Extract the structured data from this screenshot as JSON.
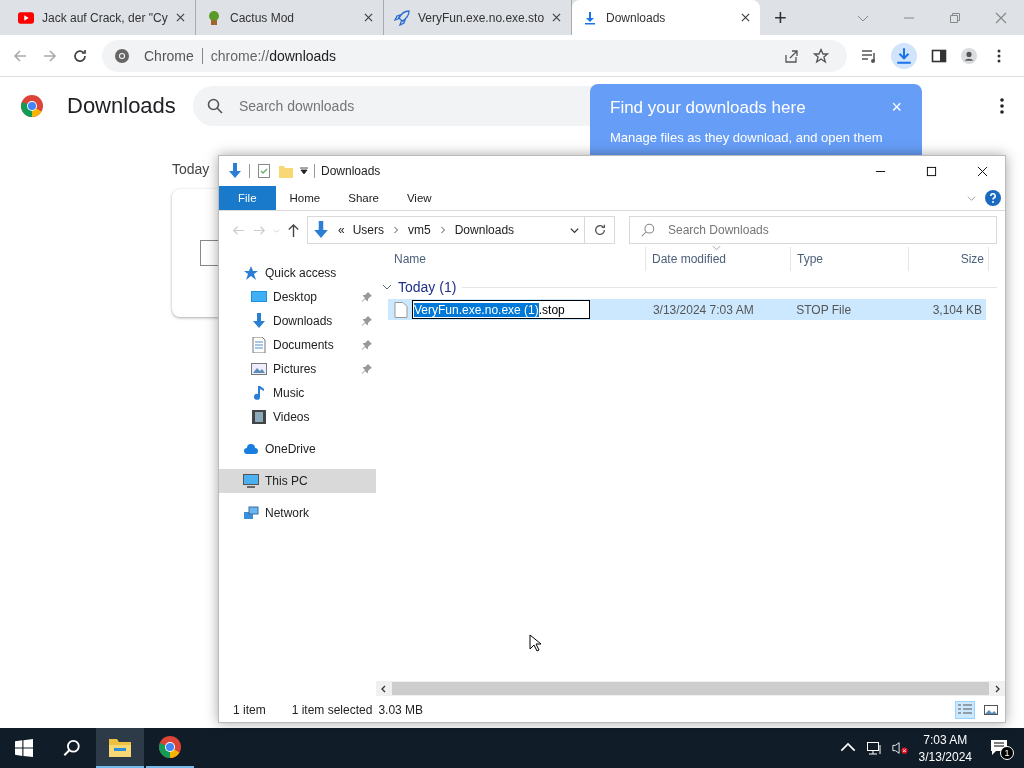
{
  "browser": {
    "tabs": [
      {
        "title": "Jack auf Crack, der \"Cy",
        "selected": false
      },
      {
        "title": "Cactus Mod",
        "selected": false
      },
      {
        "title": "VeryFun.exe.no.exe.sto",
        "selected": false
      },
      {
        "title": "Downloads",
        "selected": true
      }
    ],
    "new_tab": "+",
    "omnibox": {
      "site": "Chrome",
      "url_scheme": "chrome://",
      "url_path": "downloads"
    }
  },
  "page": {
    "title": "Downloads",
    "search": {
      "placeholder": "Search downloads"
    },
    "section": "Today",
    "promo": {
      "title": "Find your downloads here",
      "body": "Manage files as they download, and open them",
      "close": "×"
    }
  },
  "explorer": {
    "title": "Downloads",
    "ribbon_tabs": [
      {
        "label": "File",
        "selected": true
      },
      {
        "label": "Home",
        "selected": false
      },
      {
        "label": "Share",
        "selected": false
      },
      {
        "label": "View",
        "selected": false
      }
    ],
    "address": {
      "overflow": "«",
      "path": [
        "Users",
        "vm5",
        "Downloads"
      ]
    },
    "search": {
      "placeholder": "Search Downloads"
    },
    "nav": [
      {
        "label": "Quick access",
        "selected": false,
        "children": [
          {
            "label": "Desktop",
            "pinned": true,
            "selected": false
          },
          {
            "label": "Downloads",
            "pinned": true,
            "selected": false
          },
          {
            "label": "Documents",
            "pinned": true,
            "selected": false
          },
          {
            "label": "Pictures",
            "pinned": true,
            "selected": false
          },
          {
            "label": "Music",
            "pinned": false,
            "selected": false
          },
          {
            "label": "Videos",
            "pinned": false,
            "selected": false
          }
        ]
      },
      {
        "label": "OneDrive",
        "selected": false
      },
      {
        "label": "This PC",
        "selected": true
      },
      {
        "label": "Network",
        "selected": false
      }
    ],
    "columns": [
      "Name",
      "Date modified",
      "Type",
      "Size"
    ],
    "groups": [
      {
        "label": "Today (1)",
        "expanded": true,
        "files": [
          {
            "name_selected": "VeryFun.exe.no.exe (1)",
            "name_rest": ".stop",
            "renaming": true,
            "selected": true,
            "date": "3/13/2024 7:03 AM",
            "type": "STOP File",
            "size": "3,104 KB"
          }
        ]
      }
    ],
    "status": {
      "count": "1 item",
      "selection": "1 item selected",
      "selection_size": "3.03 MB"
    },
    "views": [
      {
        "kind": "details",
        "selected": true
      },
      {
        "kind": "tiles",
        "selected": false
      }
    ]
  },
  "taskbar": {
    "apps": [
      {
        "kind": "explorer",
        "selected": true
      },
      {
        "kind": "chrome",
        "selected": false
      }
    ],
    "time": "7:03 AM",
    "date": "3/13/2024",
    "notifications": "1"
  }
}
